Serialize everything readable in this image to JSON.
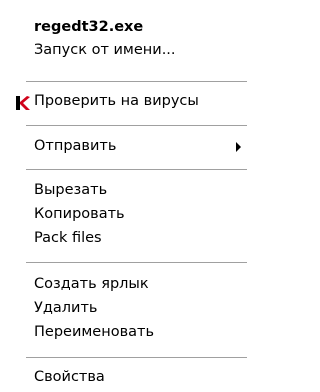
{
  "menu": {
    "items": [
      {
        "label": "regedt32.exe"
      },
      {
        "label": "Запуск от имени..."
      },
      {
        "label": "Проверить на вирусы"
      },
      {
        "label": "Отправить"
      },
      {
        "label": "Вырезать"
      },
      {
        "label": "Копировать"
      },
      {
        "label": "Pack files"
      },
      {
        "label": "Создать ярлык"
      },
      {
        "label": "Удалить"
      },
      {
        "label": "Переименовать"
      },
      {
        "label": "Свойства"
      }
    ],
    "accent_colors": {
      "kaspersky_red": "#d0021b",
      "separator": "#a0a0a0"
    }
  }
}
